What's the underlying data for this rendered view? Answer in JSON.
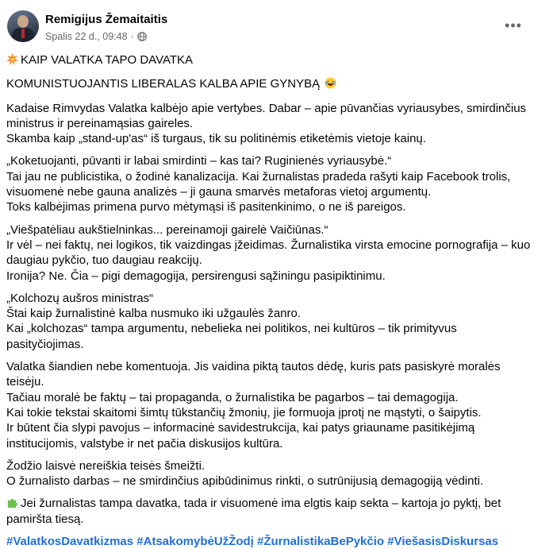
{
  "post": {
    "author": "Remigijus Žemaitaitis",
    "date": "Spalis 22 d., 09:48",
    "separator": "·",
    "more_label": "•••"
  },
  "icons": {
    "title_emoji": "collision-emoji",
    "heading_emoji": "laughing-face-emoji",
    "closing_emoji": "puzzle-piece-emoji",
    "privacy": "globe-icon"
  },
  "content": {
    "title": "KAIP VALATKA TAPO DAVATKA",
    "heading": "KOMUNISTUOJANTIS LIBERALAS KALBA APIE GYNYBĄ",
    "p1": [
      "Kadaise Rimvydas Valatka kalbėjo apie vertybes. Dabar – apie pūvančias vyriausybes, smirdinčius",
      "ministrus ir pereinamąsias gaireles.",
      "Skamba kaip „stand-up'as“ iš turgaus, tik su politinėmis etiketėmis vietoje kainų."
    ],
    "p2": [
      "„Koketuojanti, pūvanti ir labai smirdinti – kas tai? Ruginienės vyriausybė.“",
      "Tai jau ne publicistika, o žodinė kanalizacija. Kai žurnalistas pradeda rašyti kaip Facebook trolis,",
      "visuomenė nebe gauna analizės – ji gauna smarvės metaforas vietoj argumentų.",
      "Toks kalbėjimas primena purvo mėtymąsi iš pasitenkinimo, o ne iš pareigos."
    ],
    "p3": [
      "„Viešpatėliau aukštielninkas... pereinamoji gairelė Vaičiūnas.“",
      "Ir vėl – nei faktų, nei logikos, tik vaizdingas įžeidimas. Žurnalistika virsta emocine pornografija – kuo",
      "daugiau pykčio, tuo daugiau reakcijų.",
      "Ironija? Ne. Čia – pigi demagogija, persirengusi sąžiningu pasipiktinimu."
    ],
    "p4": [
      "„Kolchozų aušros ministras“",
      "Štai kaip žurnalistinė kalba nusmuko iki užgaulės žanro.",
      "Kai „kolchozas“ tampa argumentu, nebelieka nei politikos, nei kultūros – tik primityvus",
      "pasityčiojimas."
    ],
    "p5": [
      "Valatka šiandien nebe komentuoja. Jis vaidina piktą tautos dėdę, kuris pats pasiskyrė moralės",
      "teisėju.",
      "Tačiau moralė be faktų – tai propaganda, o žurnalistika be pagarbos – tai demagogija.",
      "Kai tokie tekstai skaitomi šimtų tūkstančių žmonių, jie formuoja įprotį ne mąstyti, o šaipytis.",
      "Ir būtent čia slypi pavojus – informacinė savidestrukcija, kai patys griauname pasitikėjimą",
      "institucijomis, valstybe ir net pačia diskusijos kultūra."
    ],
    "p6": [
      "Žodžio laisvė nereiškia teisės šmeižti.",
      "O žurnalisto darbas – ne smirdinčius apibūdinimus rinkti, o sutrūnijusią demagogiją vėdinti."
    ],
    "closing": [
      "Jei žurnalistas tampa davatka, tada ir visuomenė ima elgtis kaip sekta – kartoja jo pyktį, bet",
      "pamiršta tiesą."
    ],
    "hashtags": [
      "#ValatkosDavatkizmas",
      "#AtsakomybėUžŽodį",
      "#ŽurnalistikaBePykčio",
      "#ViešasisDiskursas"
    ]
  }
}
